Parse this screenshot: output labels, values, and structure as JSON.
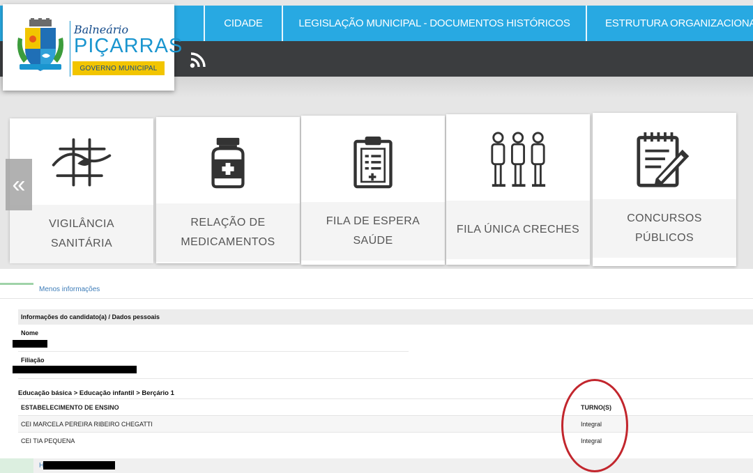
{
  "header": {
    "logo": {
      "line1": "Balneário",
      "line2": "PIÇARRAS",
      "badge": "GOVERNO MUNICIPAL"
    },
    "nav": [
      {
        "label": "CIDADE"
      },
      {
        "label": "LEGISLAÇÃO MUNICIPAL - DOCUMENTOS HISTÓRICOS"
      },
      {
        "label": "ESTRUTURA ORGANIZACIONAL"
      }
    ],
    "rss_icon": "rss-icon"
  },
  "carousel": {
    "prev_label": "«",
    "cards": [
      {
        "label": "VIGILÂNCIA SANITÁRIA",
        "icon": "health-surveillance-icon"
      },
      {
        "label": "RELAÇÃO DE MEDICAMENTOS",
        "icon": "medicine-bottle-icon"
      },
      {
        "label": "FILA DE ESPERA SAÚDE",
        "icon": "clipboard-icon"
      },
      {
        "label": "FILA ÚNICA CRECHES",
        "icon": "children-icon"
      },
      {
        "label": "CONCURSOS PÚBLICOS",
        "icon": "notepad-pencil-icon"
      }
    ]
  },
  "candidate": {
    "less_info_link": "Menos informações",
    "section_title": "Informações do candidato(a) / Dados pessoais",
    "name_label": "Nome",
    "filiation_label": "Filiação",
    "breadcrumb": "Educação básica > Educação infantil > Berçário 1",
    "table": {
      "headers": [
        "ESTABELECIMENTO DE ENSINO",
        "TURNO(S)"
      ],
      "rows": [
        [
          "CEI MARCELA PEREIRA RIBEIRO CHEGATTI",
          "Integral"
        ],
        [
          "CEI TIA PEQUENA",
          "Integral"
        ]
      ]
    },
    "next_item_prefix": "H"
  },
  "colors": {
    "nav_blue": "#28a9e2",
    "dark_bar": "#3b3d3f",
    "badge_yellow": "#f2c500",
    "circle_red": "#c2262d"
  }
}
